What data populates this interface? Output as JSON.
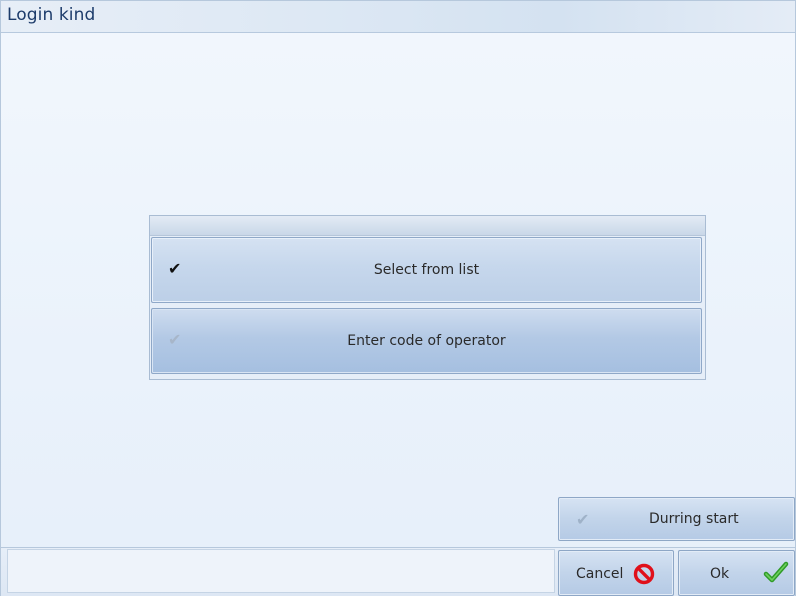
{
  "window": {
    "title": "Login kind"
  },
  "login_options": {
    "items": [
      {
        "label": "Select from list",
        "selected": true,
        "icon": "checkmark-icon"
      },
      {
        "label": "Enter code of operator",
        "selected": false,
        "icon": "checkmark-icon"
      }
    ]
  },
  "during_start": {
    "label": "Durring start",
    "checked": false,
    "icon": "checkmark-icon"
  },
  "footer": {
    "cancel_label": "Cancel",
    "cancel_icon": "prohibited-icon",
    "ok_label": "Ok",
    "ok_icon": "green-checkmark-icon"
  },
  "colors": {
    "title_text": "#1d3c6b",
    "cancel_icon": "#e0101a",
    "ok_icon": "#3aa52c"
  }
}
